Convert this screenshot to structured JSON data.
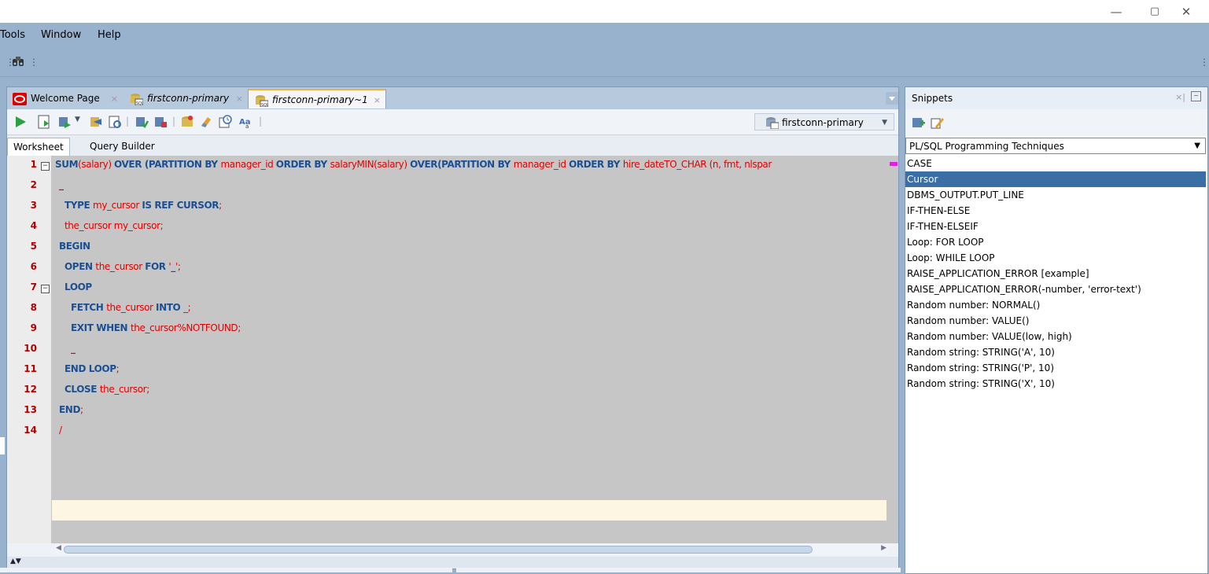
{
  "window": {
    "minimize": "—",
    "restore": "▢",
    "close": "✕"
  },
  "menu": {
    "tools": "Tools",
    "window": "Window",
    "help": "Help"
  },
  "tabs": [
    {
      "label": "Welcome Page",
      "close": "×"
    },
    {
      "label": "firstconn-primary",
      "close": "×"
    },
    {
      "label": "firstconn-primary~1",
      "close": "×"
    }
  ],
  "connection": {
    "selected": "firstconn-primary"
  },
  "subtabs": {
    "worksheet": "Worksheet",
    "query_builder": "Query Builder"
  },
  "code": {
    "line_numbers": [
      "1",
      "2",
      "3",
      "4",
      "5",
      "6",
      "7",
      "8",
      "9",
      "10",
      "11",
      "12",
      "13",
      "14"
    ],
    "l1": {
      "a": "SUM",
      "b": "(salary) ",
      "c": "OVER (PARTITION BY ",
      "d": "manager_id ",
      "e": "ORDER BY ",
      "f": "salaryMIN(salary) ",
      "g": "OVER(PARTITION BY ",
      "h": "manager_id ",
      "i": "ORDER BY ",
      "j": "hire_dateTO_CHAR (n, fmt, nlspar"
    },
    "l2": "_",
    "l3": {
      "a": "TYPE ",
      "b": "my_cursor ",
      "c": "IS REF CURSOR",
      "d": ";"
    },
    "l4": "the_cursor my_cursor;",
    "l5": "BEGIN",
    "l6": {
      "a": "OPEN ",
      "b": "the_cursor ",
      "c": "FOR ",
      "d": "'",
      "e": "_",
      "f": "';"
    },
    "l7": "LOOP",
    "l8": {
      "a": "FETCH ",
      "b": "the_cursor ",
      "c": "INTO ",
      "d": "_;"
    },
    "l9": {
      "a": "EXIT WHEN ",
      "b": "the_cursor%NOTFOUND;"
    },
    "l10": "_",
    "l11": {
      "a": "END LOOP",
      "b": ";"
    },
    "l12": {
      "a": "CLOSE ",
      "b": "the_cursor;"
    },
    "l13": {
      "a": "END",
      "b": ";"
    },
    "l14": "/"
  },
  "snippets": {
    "title": "Snippets",
    "category": "PL/SQL Programming Techniques",
    "items": [
      "CASE",
      "Cursor",
      "DBMS_OUTPUT.PUT_LINE",
      "IF-THEN-ELSE",
      "IF-THEN-ELSEIF",
      "Loop: FOR LOOP",
      "Loop: WHILE LOOP",
      "RAISE_APPLICATION_ERROR [example]",
      "RAISE_APPLICATION_ERROR(-number, 'error-text')",
      "Random number: NORMAL()",
      "Random number: VALUE()",
      "Random number: VALUE(low, high)",
      "Random string: STRING('A', 10)",
      "Random string: STRING('P', 10)",
      "Random string: STRING('X', 10)"
    ],
    "selected_index": 1
  },
  "colors": {
    "keyword": "#1d4f91",
    "identifier": "#e00000",
    "selection": "#3a6ea5"
  }
}
